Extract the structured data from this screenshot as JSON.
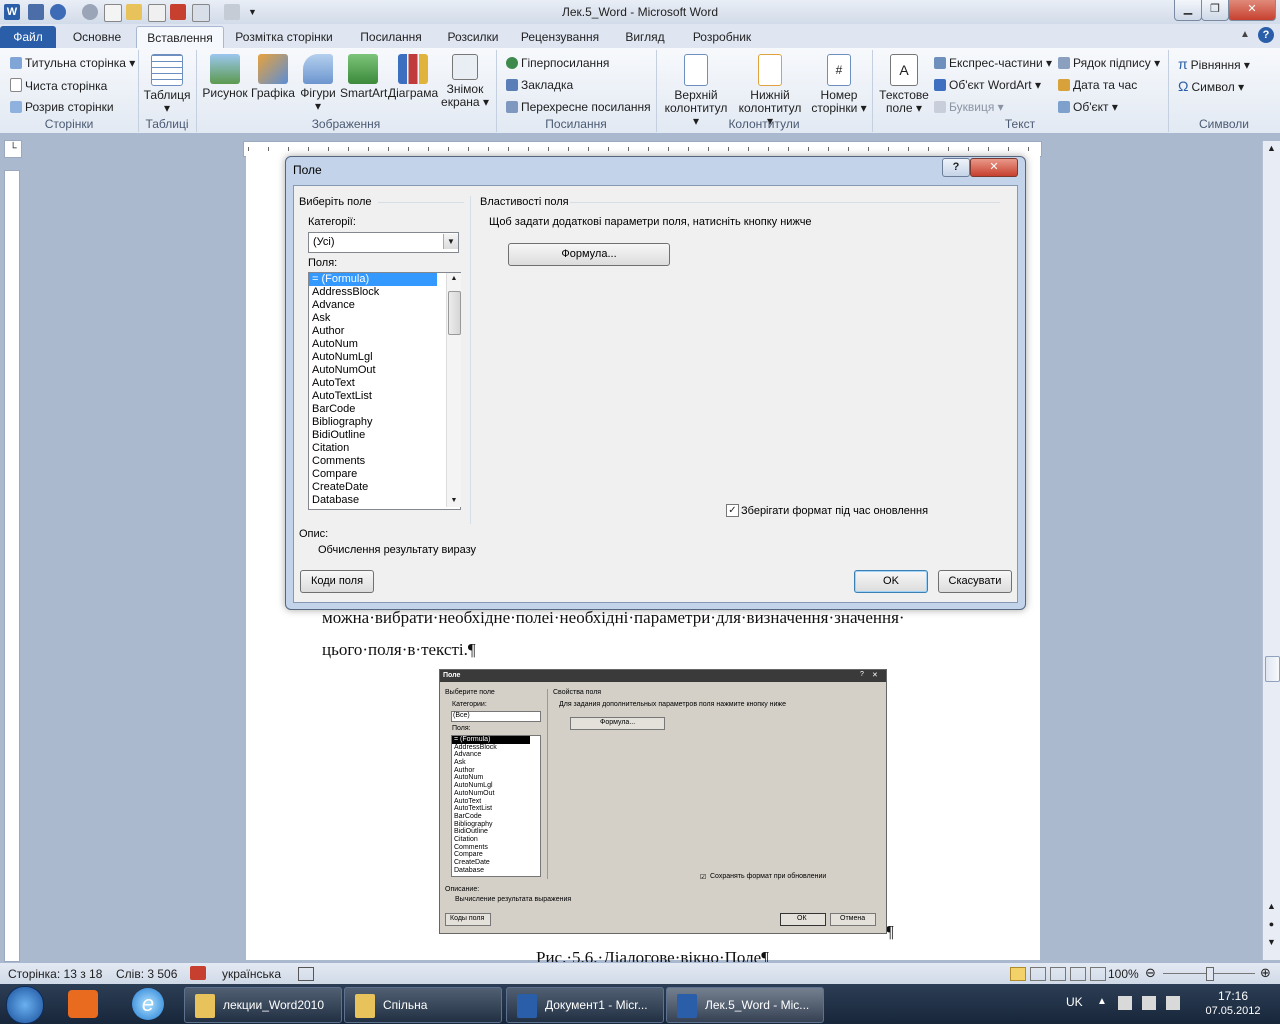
{
  "window": {
    "title": "Лек.5_Word  -  Microsoft Word"
  },
  "tabs": [
    "Файл",
    "Основне",
    "Вставлення",
    "Розмітка сторінки",
    "Посилання",
    "Розсилки",
    "Рецензування",
    "Вигляд",
    "Розробник"
  ],
  "ribbon": {
    "pages": {
      "label": "Сторінки",
      "items": [
        "Титульна сторінка",
        "Чиста сторінка",
        "Розрив сторінки"
      ]
    },
    "tables": {
      "label": "Таблиці",
      "button": "Таблиця"
    },
    "illustrations": {
      "label": "Зображення",
      "buttons": [
        "Рисунок",
        "Графіка",
        "Фігури",
        "SmartArt",
        "Діаграма",
        "Знімок екрана"
      ]
    },
    "links": {
      "label": "Посилання",
      "items": [
        "Гіперпосилання",
        "Закладка",
        "Перехресне посилання"
      ]
    },
    "headerfooter": {
      "label": "Колонтитули",
      "buttons": [
        "Верхній колонтитул",
        "Нижній колонтитул",
        "Номер сторінки"
      ]
    },
    "text": {
      "label": "Текст",
      "button": "Текстове поле",
      "items": [
        "Експрес-частини",
        "Об'єкт WordArt",
        "Буквиця",
        "Рядок підпису",
        "Дата та час",
        "Об'єкт"
      ]
    },
    "symbols": {
      "label": "Символи",
      "items": [
        "Рівняння",
        "Символ"
      ]
    }
  },
  "dialog": {
    "title": "Поле",
    "choose_field": "Виберіть поле",
    "categories_label": "Категорії:",
    "category_value": "(Усі)",
    "fields_label": "Поля:",
    "fields": [
      "= (Formula)",
      "AddressBlock",
      "Advance",
      "Ask",
      "Author",
      "AutoNum",
      "AutoNumLgl",
      "AutoNumOut",
      "AutoText",
      "AutoTextList",
      "BarCode",
      "Bibliography",
      "BidiOutline",
      "Citation",
      "Comments",
      "Compare",
      "CreateDate",
      "Database"
    ],
    "properties_title": "Властивості поля",
    "properties_hint": "Щоб задати додаткові параметри поля, натисніть кнопку нижче",
    "formula_button": "Формула...",
    "preserve_format": "Зберігати формат під час оновлення",
    "description_label": "Опис:",
    "description_text": "Обчислення результату виразу",
    "field_codes_button": "Коди поля",
    "ok_button": "OK",
    "cancel_button": "Скасувати"
  },
  "document": {
    "line1": "можна·вибрати·необхідне·полеі·необхідні·параметри·для·визначення·значення·",
    "line2": "цього·поля·в·тексті.¶",
    "caption": "Рис.·5.6.·Діалогове·вікно·Поле¶",
    "pilcrow": "¶"
  },
  "figure": {
    "title": "Поле",
    "choose_field": "Выберите поле",
    "categories_label": "Категории:",
    "category_value": "(Все)",
    "fields_label": "Поля:",
    "fields": [
      "= (Formula)",
      "AddressBlock",
      "Advance",
      "Ask",
      "Author",
      "AutoNum",
      "AutoNumLgl",
      "AutoNumOut",
      "AutoText",
      "AutoTextList",
      "BarCode",
      "Bibliography",
      "BidiOutline",
      "Citation",
      "Comments",
      "Compare",
      "CreateDate",
      "Database"
    ],
    "properties_title": "Свойства поля",
    "properties_hint": "Для задания дополнительных параметров поля нажмите кнопку ниже",
    "formula_button": "Формула...",
    "preserve_format": "Сохранять формат при обновлении",
    "description_label": "Описание:",
    "description_text": "Вычисление результата выражения",
    "field_codes_button": "Коды поля",
    "ok_button": "ОК",
    "cancel_button": "Отмена"
  },
  "statusbar": {
    "page": "Сторінка: 13 з 18",
    "words": "Слів: 3 506",
    "language": "українська",
    "zoom": "100%"
  },
  "taskbar": {
    "items": [
      "лекции_Word2010",
      "Спільна",
      "Документ1 - Micr...",
      "Лек.5_Word - Mic..."
    ],
    "lang": "UK",
    "time": "17:16",
    "date": "07.05.2012"
  },
  "colors": {
    "accent": "#2a5ea8",
    "ribbon_bg": "#e2e9f3",
    "close_red": "#c7402f",
    "selection": "#3399ff"
  }
}
